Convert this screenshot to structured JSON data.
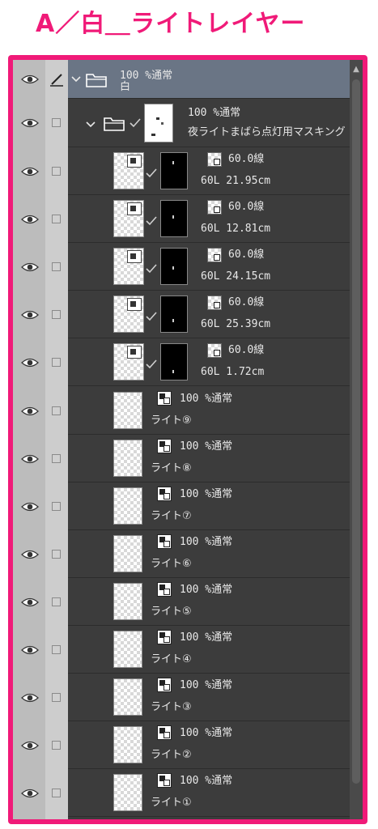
{
  "heading": "A／白＿ライトレイヤー",
  "colors": {
    "frame": "#f01a78",
    "selected_row": "#6a7585",
    "panel": "#3c3c3c"
  },
  "folder_white": {
    "opacity_mode": "100 %通常",
    "name": "白"
  },
  "folder_mask": {
    "opacity_mode": "100 %通常",
    "name": "夜ライトまばら点灯用マスキング"
  },
  "line_layers": [
    {
      "mode": "60.0線",
      "info": "60L 21.95cm"
    },
    {
      "mode": "60.0線",
      "info": "60L 12.81cm"
    },
    {
      "mode": "60.0線",
      "info": "60L 24.15cm"
    },
    {
      "mode": "60.0線",
      "info": "60L 25.39cm"
    },
    {
      "mode": "60.0線",
      "info": "60L 1.72cm"
    }
  ],
  "light_layers": [
    {
      "mode": "100 %通常",
      "name": "ライト⑨"
    },
    {
      "mode": "100 %通常",
      "name": "ライト⑧"
    },
    {
      "mode": "100 %通常",
      "name": "ライト⑦"
    },
    {
      "mode": "100 %通常",
      "name": "ライト⑥"
    },
    {
      "mode": "100 %通常",
      "name": "ライト⑤"
    },
    {
      "mode": "100 %通常",
      "name": "ライト④"
    },
    {
      "mode": "100 %通常",
      "name": "ライト③"
    },
    {
      "mode": "100 %通常",
      "name": "ライト②"
    },
    {
      "mode": "100 %通常",
      "name": "ライト①"
    }
  ],
  "icons": {
    "eye": "eye-icon",
    "pen": "pen-icon",
    "folder": "folder-icon",
    "chevron": "chevron-down-icon",
    "check": "check-icon",
    "layer_type": "layer-type-icon",
    "scroll_up": "▲"
  }
}
